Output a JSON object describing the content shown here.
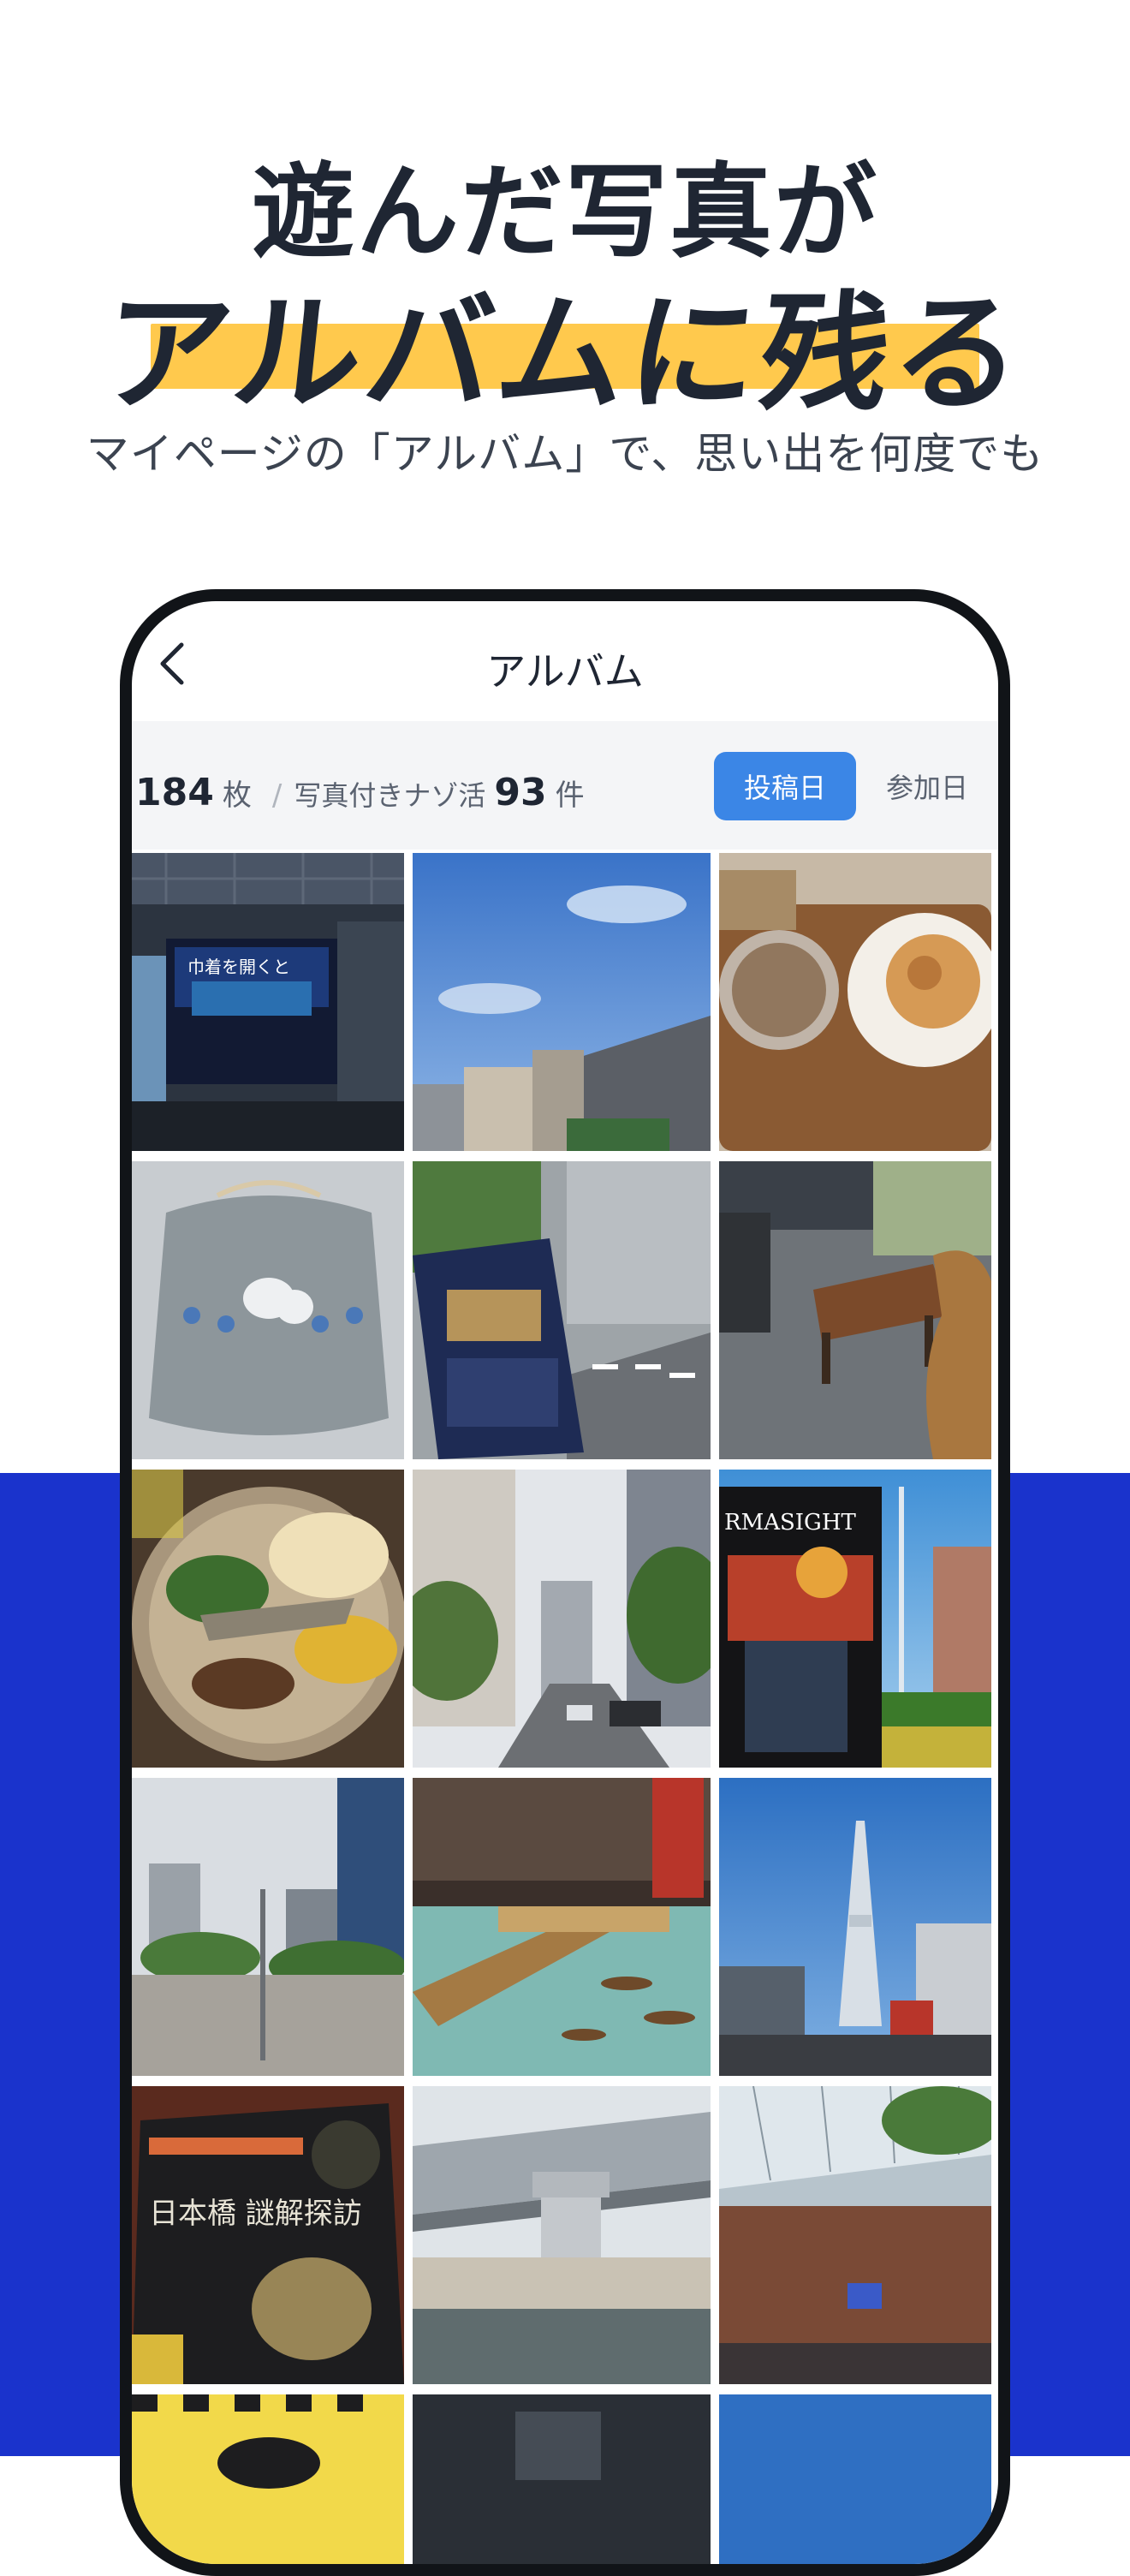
{
  "header": {
    "line1": "遊んだ写真が",
    "line2": "アルバムに残る",
    "subtitle": "マイページの「アルバム」で、思い出を何度でも"
  },
  "colors": {
    "accent_yellow": "#ffc94d",
    "band_blue": "#1a33cc",
    "active_tab": "#3b86e6",
    "text_dark": "#1f2633"
  },
  "app": {
    "title": "アルバム",
    "back_icon": "chevron-left-icon",
    "summary": {
      "photo_count": "184",
      "photo_unit": "枚",
      "separator": "/",
      "mystery_label": "写真付きナゾ活",
      "mystery_count": "93",
      "mystery_unit": "件"
    },
    "sort": {
      "options": [
        "投稿日",
        "参加日"
      ],
      "selected": "投稿日"
    }
  },
  "photos": [
    {
      "name": "photo-museum-lobby-screen",
      "text": "巾着を開くと"
    },
    {
      "name": "photo-blue-sky-buildings"
    },
    {
      "name": "photo-iced-coffee-cookie"
    },
    {
      "name": "photo-drawstring-bag"
    },
    {
      "name": "photo-puzzle-booklet-street"
    },
    {
      "name": "photo-bench-bronze-statue"
    },
    {
      "name": "photo-curry-plate-fish"
    },
    {
      "name": "photo-city-street"
    },
    {
      "name": "photo-poster-skytree",
      "text": "RMASIGHT"
    },
    {
      "name": "photo-plaza-buildings"
    },
    {
      "name": "photo-museum-diorama-bridge"
    },
    {
      "name": "photo-skytree"
    },
    {
      "name": "photo-nihonbashi-booklet",
      "text": "日本橋 謎解探訪"
    },
    {
      "name": "photo-highway-over-river"
    },
    {
      "name": "photo-shopping-arcade"
    },
    {
      "name": "photo-yellow-poster"
    },
    {
      "name": "photo-dark-building"
    },
    {
      "name": "photo-blue-sky-edge"
    }
  ]
}
